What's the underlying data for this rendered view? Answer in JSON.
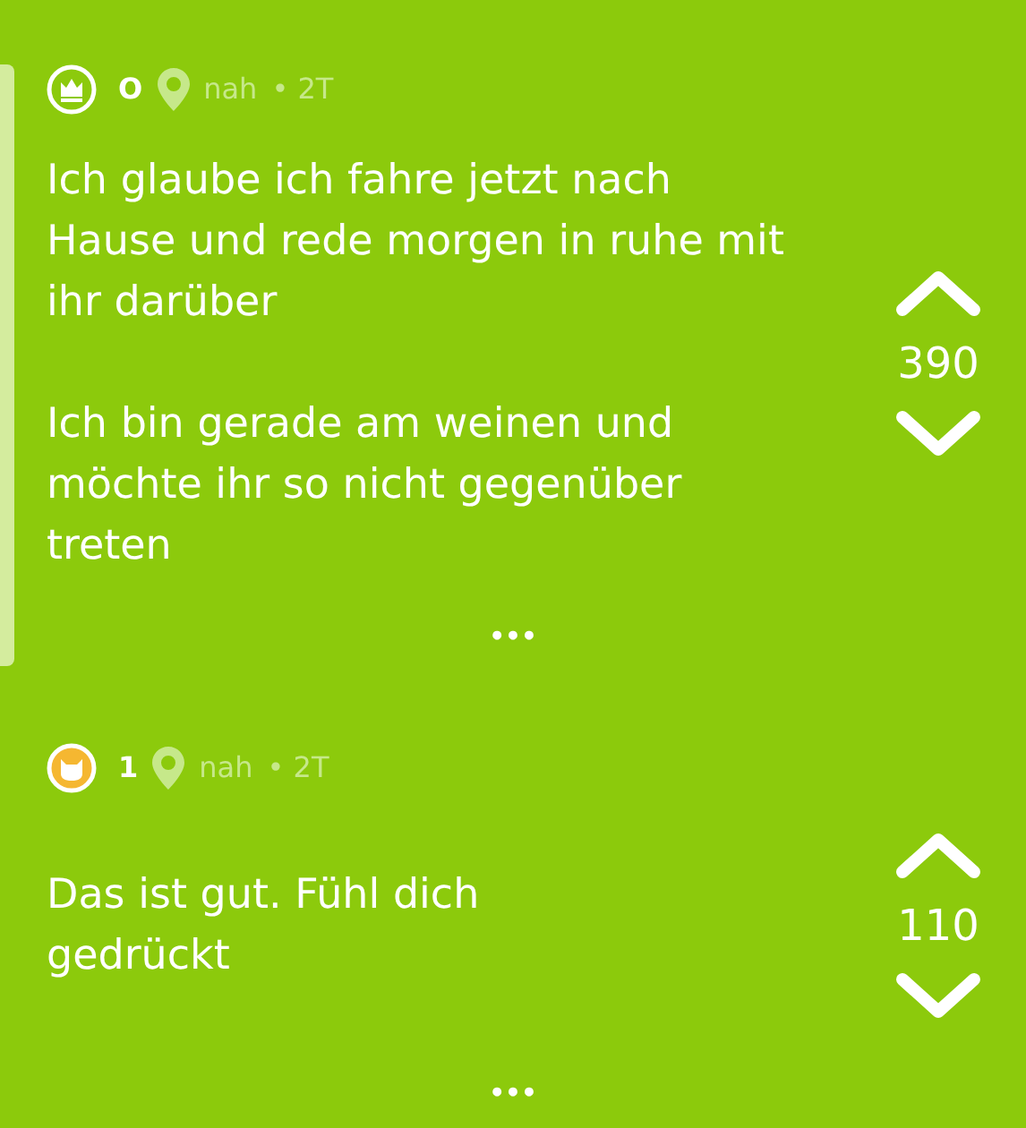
{
  "posts": [
    {
      "kind": "crown",
      "author": "O",
      "location": "nah",
      "time": "• 2T",
      "highlighted": true,
      "paragraphs": [
        "Ich glaube ich fahre jetzt nach Hause und rede morgen in ruhe mit ihr darüber",
        "Ich bin gerade am weinen und möchte ihr so nicht gegenüber treten"
      ],
      "votes": "390",
      "more": "•••"
    },
    {
      "kind": "cat",
      "author": "1",
      "location": "nah",
      "time": "• 2T",
      "highlighted": false,
      "paragraphs": [
        "Das ist gut. Fühl dich gedrückt"
      ],
      "votes": "110",
      "more": "•••"
    }
  ]
}
